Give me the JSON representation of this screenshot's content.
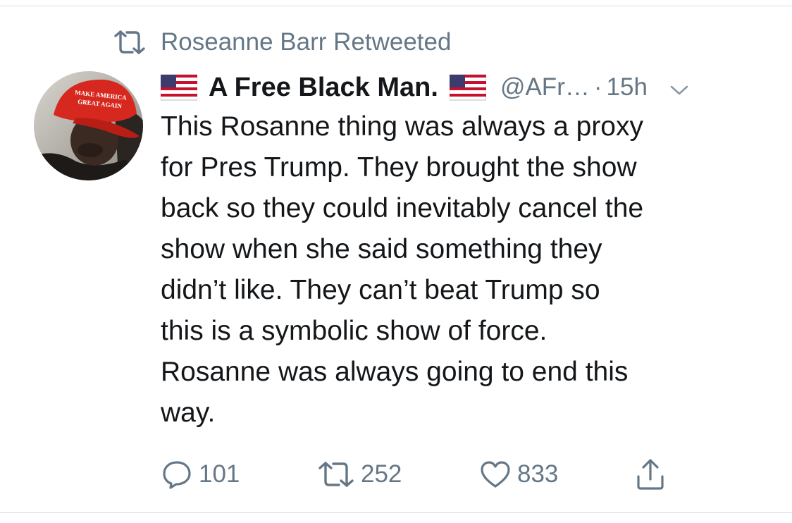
{
  "retweet_context": {
    "label": "Roseanne Barr Retweeted",
    "icon": "retweet-icon"
  },
  "tweet": {
    "avatar": {
      "hat_text_line1": "MAKE AMERICA",
      "hat_text_line2": "GREAT AGAIN"
    },
    "display_name": "A Free Black Man.",
    "handle": "@AFr…",
    "separator": "·",
    "timestamp": "15h",
    "flag_icon": "us-flag-icon",
    "text": "This Rosanne thing was always a proxy\nfor Pres Trump. They brought the show\nback so they could inevitably cancel the\nshow when she said something they\ndidn’t like. They can’t beat Trump so\nthis is a symbolic show of force.\nRosanne was always going to end this\nway."
  },
  "actions": {
    "reply_count": "101",
    "retweet_count": "252",
    "like_count": "833"
  },
  "colors": {
    "text_primary": "#14171a",
    "text_secondary": "#657786",
    "border": "#d8dde1",
    "hat_red": "#d6281e"
  }
}
